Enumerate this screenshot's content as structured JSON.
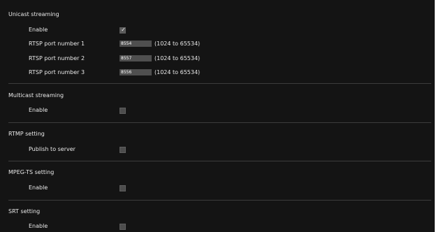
{
  "unicast": {
    "title": "Unicast streaming",
    "enable_label": "Enable",
    "enable_checked": true,
    "ports": [
      {
        "label": "RTSP port number 1",
        "value": "8554",
        "range": "(1024 to 65534)"
      },
      {
        "label": "RTSP port number 2",
        "value": "8557",
        "range": "(1024 to 65534)"
      },
      {
        "label": "RTSP port number 3",
        "value": "8556",
        "range": "(1024 to 65534)"
      }
    ]
  },
  "multicast": {
    "title": "Multicast streaming",
    "enable_label": "Enable",
    "enable_checked": false
  },
  "rtmp": {
    "title": "RTMP setting",
    "publish_label": "Publish to server",
    "publish_checked": false
  },
  "mpegts": {
    "title": "MPEG-TS setting",
    "enable_label": "Enable",
    "enable_checked": false
  },
  "srt": {
    "title": "SRT setting",
    "enable_label": "Enable",
    "enable_checked": false
  },
  "colors": {
    "panel_background": "#141414",
    "text": "#e9e9e9",
    "field_background": "#4f4f4f",
    "divider": "#3c3c3c"
  },
  "icons": {
    "checkmark": "checkmark-icon"
  }
}
